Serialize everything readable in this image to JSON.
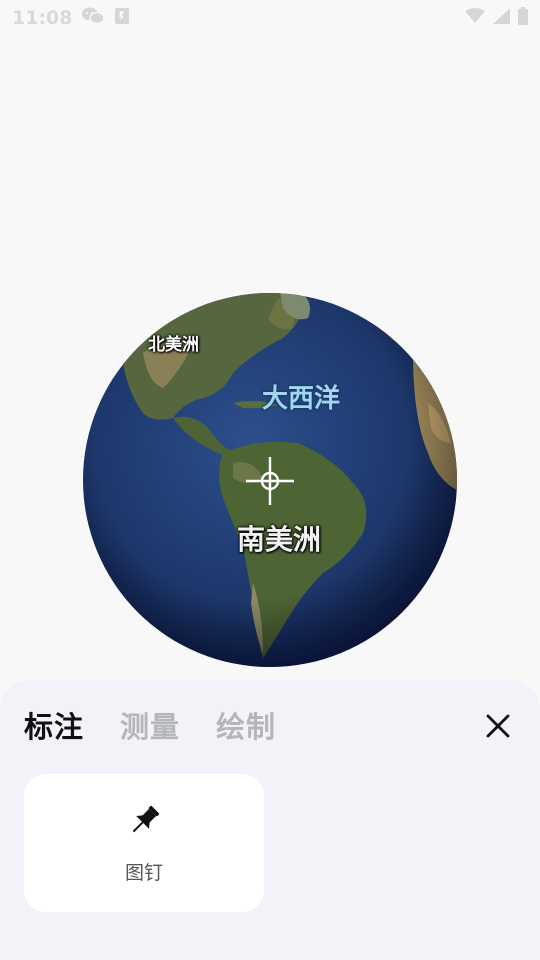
{
  "status_bar": {
    "time": "11:08",
    "left_icons": [
      "wechat-icon",
      "notification-icon"
    ],
    "right_icons": [
      "wifi-icon",
      "signal-icon",
      "battery-icon"
    ]
  },
  "map": {
    "labels": {
      "north_america": "北美洲",
      "atlantic": "大西洋",
      "south_america": "南美洲"
    },
    "center_marker": "crosshair-icon"
  },
  "panel": {
    "tabs": [
      {
        "label": "标注",
        "active": true
      },
      {
        "label": "测量",
        "active": false
      },
      {
        "label": "绘制",
        "active": false
      }
    ],
    "close_icon": "close-icon",
    "tools": [
      {
        "label": "图钉",
        "icon": "pin-icon"
      }
    ]
  },
  "colors": {
    "background": "#f8f8f9",
    "panel_background": "#f2f3f8",
    "card_background": "#ffffff",
    "active_tab": "#111111",
    "inactive_tab": "#b4b6bb"
  }
}
